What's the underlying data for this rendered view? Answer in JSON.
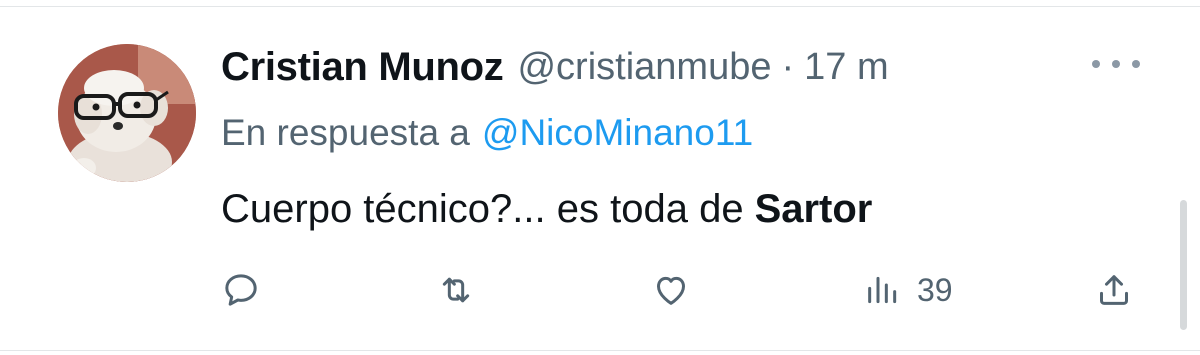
{
  "tweet": {
    "display_name": "Cristian Munoz",
    "handle": "@cristianmube",
    "separator": "·",
    "time": "17 m",
    "reply_prefix": "En respuesta a",
    "reply_mention": "@NicoMinano11",
    "text_normal": "Cuerpo técnico?... es toda de",
    "text_bold": "Sartor"
  },
  "actions": {
    "reply_icon": "reply-icon",
    "retweet_icon": "retweet-icon",
    "like_icon": "heart-icon",
    "views_icon": "views-chart-icon",
    "views_count": "39",
    "share_icon": "share-icon"
  },
  "colors": {
    "text": "#0f1419",
    "secondary": "#536471",
    "link": "#1d9bf0"
  }
}
